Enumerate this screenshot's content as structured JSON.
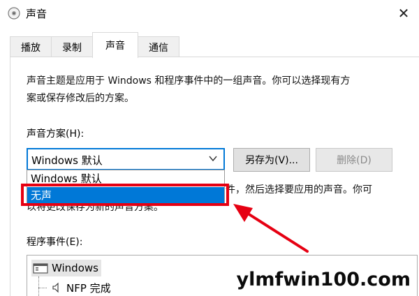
{
  "window": {
    "title": "声音",
    "close_glyph": "✕"
  },
  "tabs": [
    {
      "label": "播放",
      "active": false
    },
    {
      "label": "录制",
      "active": false
    },
    {
      "label": "声音",
      "active": true
    },
    {
      "label": "通信",
      "active": false
    }
  ],
  "description": {
    "line1": "声音主题是应用于 Windows 和程序事件中的一组声音。你可以选择现有方",
    "line2": "案或保存修改后的方案。"
  },
  "scheme": {
    "label": "声音方案(H):",
    "value": "Windows 默认",
    "options": [
      "Windows 默认",
      "无声"
    ],
    "selected_index": 1
  },
  "buttons": {
    "save_as": "另存为(V)...",
    "delete": "删除(D)"
  },
  "partial_text": {
    "line1": "件，然后选择要应用的声音。你可",
    "line2": "以将更改保存为新的声音方案。"
  },
  "events": {
    "label": "程序事件(E):",
    "root": "Windows",
    "child": "NFP 完成"
  },
  "watermark": "ylmfwin100.com",
  "colors": {
    "accent": "#0078d7",
    "annotation": "#e60012"
  }
}
